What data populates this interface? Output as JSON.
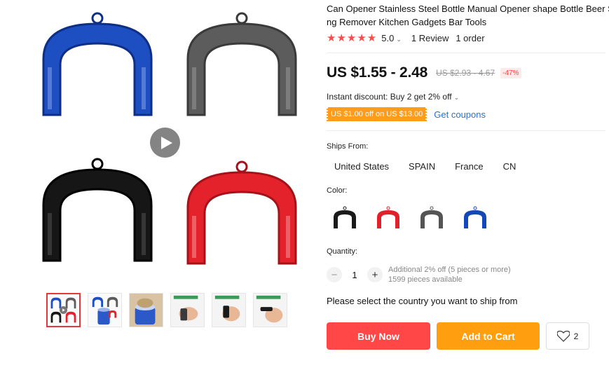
{
  "product": {
    "title": "Can Opener Stainless Steel Bottle Manual Opener shape Bottle Beer Screwdriver Bottle Cap Remover Kitchen Gadgets Bar Tools",
    "title_line1": "Can Opener Stainless Steel Bottle Manual Opener shape Bottle Beer S",
    "title_line2": "ng Remover Kitchen Gadgets Bar Tools"
  },
  "rating": {
    "stars": "★★★★★",
    "value": "5.0",
    "reviews": "1 Review",
    "orders": "1 order"
  },
  "price": {
    "range": "US $1.55 - 2.48",
    "original": "US $2.93 - 4.67",
    "discount": "-47%"
  },
  "instant_discount": "Instant discount: Buy 2 get 2% off",
  "coupon": {
    "label": "US $1.00 off on US $13.00",
    "get_link": "Get coupons"
  },
  "ships_from": {
    "label": "Ships From:",
    "options": [
      "United States",
      "SPAIN",
      "France",
      "CN"
    ]
  },
  "color": {
    "label": "Color:",
    "options": [
      {
        "name": "black",
        "hex": "#1a1a1a"
      },
      {
        "name": "red",
        "hex": "#e0202a"
      },
      {
        "name": "gray",
        "hex": "#555555"
      },
      {
        "name": "blue",
        "hex": "#1448b8"
      }
    ]
  },
  "quantity": {
    "label": "Quantity:",
    "value": "1",
    "minus": "−",
    "plus": "+",
    "note1": "Additional 2% off (5 pieces or more)",
    "note2": "1599 pieces available"
  },
  "ship_message": "Please select the country you want to ship from",
  "buttons": {
    "buy_now": "Buy Now",
    "add_to_cart": "Add to Cart",
    "wishlist_count": "2"
  },
  "colors": {
    "accent_red": "#ff4747",
    "accent_orange": "#ff9f0f",
    "link_blue": "#2a72c8",
    "star": "#f74d4d"
  }
}
